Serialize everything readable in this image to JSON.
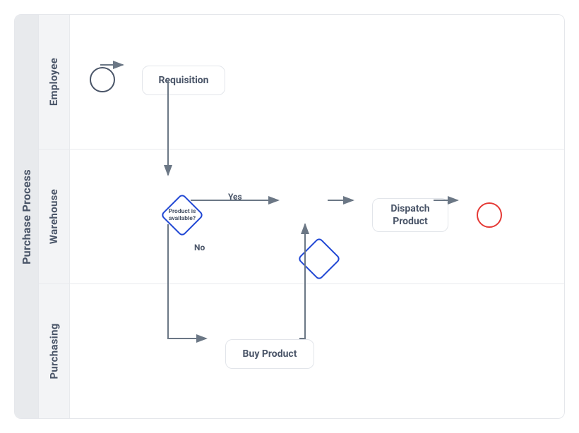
{
  "pool": {
    "title": "Purchase Process"
  },
  "lanes": [
    {
      "title": "Employee"
    },
    {
      "title": "Warehouse"
    },
    {
      "title": "Purchasing"
    }
  ],
  "nodes": {
    "start": {
      "type": "start"
    },
    "requisition": {
      "label": "Requisition"
    },
    "gw_avail": {
      "label": "Product is available?"
    },
    "gw_merge": {
      "label": ""
    },
    "dispatch": {
      "label": "Dispatch\nProduct"
    },
    "buy": {
      "label": "Buy Product"
    },
    "end": {
      "type": "end"
    }
  },
  "edges": {
    "yes": "Yes",
    "no": "No"
  },
  "colors": {
    "text": "#4a5568",
    "gateway_border": "#2047d4",
    "end_border": "#e53935",
    "lane_border": "#e8eaed"
  }
}
